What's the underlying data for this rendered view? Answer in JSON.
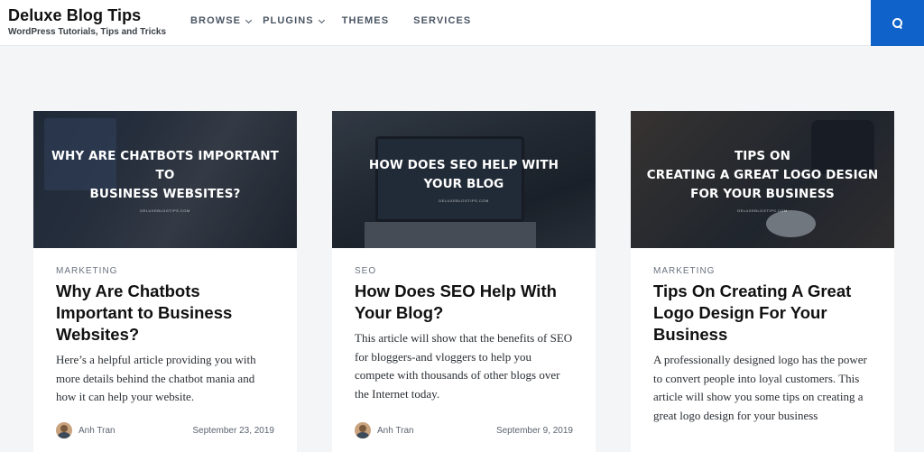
{
  "site": {
    "title": "Deluxe Blog Tips",
    "tagline": "WordPress Tutorials, Tips and Tricks"
  },
  "nav": [
    {
      "label": "BROWSE",
      "has_dropdown": true
    },
    {
      "label": "PLUGINS",
      "has_dropdown": true
    },
    {
      "label": "THEMES",
      "has_dropdown": false
    },
    {
      "label": "SERVICES",
      "has_dropdown": false
    }
  ],
  "search": {
    "icon": "search-icon",
    "color": "#0f62c9"
  },
  "posts": [
    {
      "image_title": "WHY ARE CHATBOTS IMPORTANT TO\nBUSINESS WEBSITES?",
      "image_credit": "DELUXEBLOGTIPS.COM",
      "category": "MARKETING",
      "title": "Why Are Chatbots Important to Business Websites?",
      "excerpt": "Here’s a helpful article providing you with more details behind the chatbot mania and how it can help your website.",
      "author": "Anh Tran",
      "date": "September 23, 2019"
    },
    {
      "image_title": "HOW DOES SEO HELP WITH\nYOUR BLOG",
      "image_credit": "DELUXEBLOGTIPS.COM",
      "category": "SEO",
      "title": "How Does SEO Help With Your Blog?",
      "excerpt": "This article will show that the benefits of SEO for bloggers-and vloggers to help you compete with thousands of other blogs over the Internet today.",
      "author": "Anh Tran",
      "date": "September 9, 2019"
    },
    {
      "image_title": "TIPS ON\nCREATING A GREAT LOGO DESIGN\nFOR YOUR BUSINESS",
      "image_credit": "DELUXEBLOGTIPS.COM",
      "category": "MARKETING",
      "title": "Tips On Creating A Great Logo Design For Your Business",
      "excerpt": "A professionally designed logo has the power to convert people into loyal customers. This article will show you some tips on creating a great logo design for your business",
      "author": "",
      "date": ""
    }
  ]
}
